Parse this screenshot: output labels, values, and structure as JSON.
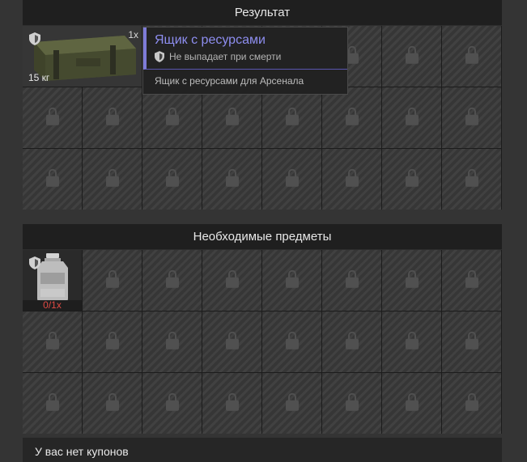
{
  "result": {
    "header": "Результат",
    "item": {
      "icon": "ammo-crate-icon",
      "count": "1x",
      "weight": "15 кг"
    },
    "tooltip": {
      "title": "Ящик с ресурсами",
      "subtitle": "Не выпадает при смерти",
      "description": "Ящик с ресурсами для Арсенала",
      "accent_color": "#8e8ef0"
    }
  },
  "required": {
    "header": "Необходимые предметы",
    "item": {
      "icon": "canister-icon",
      "count": "0/1x",
      "count_color": "#e04a44"
    }
  },
  "coupons": {
    "text": "У вас нет купонов"
  }
}
